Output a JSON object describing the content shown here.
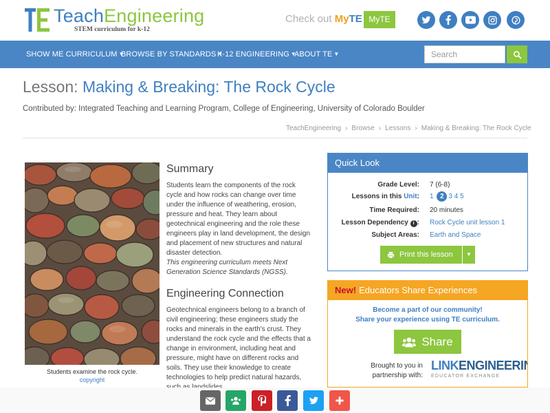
{
  "header": {
    "logo_teach": "Teach",
    "logo_engineering": "Engineering",
    "logo_tagline": "STEM curriculum for k-12",
    "checkout_prefix": "Check out ",
    "checkout_my": "My",
    "checkout_te": "TE",
    "myte_button": "MyTE",
    "social_icons": [
      "twitter-icon",
      "facebook-icon",
      "youtube-icon",
      "instagram-icon",
      "pinterest-icon"
    ]
  },
  "nav": {
    "items": [
      {
        "label": "SHOW ME CURRICULUM"
      },
      {
        "label": "BROWSE BY STANDARDS"
      },
      {
        "label": "K-12 ENGINEERING"
      },
      {
        "label": "ABOUT TE"
      }
    ],
    "search_placeholder": "Search"
  },
  "lesson": {
    "title_prefix": "Lesson:",
    "title": "Making & Breaking: The Rock Cycle",
    "contributed_by": "Contributed by: Integrated Teaching and Learning Program, College of Engineering, University of Colorado Boulder",
    "breadcrumbs": [
      "TeachEngineering",
      "Browse",
      "Lessons",
      "Making & Breaking: The Rock Cycle"
    ]
  },
  "image": {
    "caption": "Students examine the rock cycle.",
    "copyright": "copyright"
  },
  "summary": {
    "heading": "Summary",
    "text": "Students learn the components of the rock cycle and how rocks can change over time under the influence of weathering, erosion, pressure and heat. They learn about geotechnical engineering and the role these engineers play in land development, the design and placement of new structures and natural disaster detection.",
    "ngss_note": "This engineering curriculum meets Next Generation Science Standards (NGSS)."
  },
  "engineering_connection": {
    "heading": "Engineering Connection",
    "text": "Geotechnical engineers belong to a branch of civil engineering; these engineers study the rocks and minerals in the earth's crust. They understand the rock cycle and the effects that a change in environment, including heat and pressure, might have on different rocks and soils. They use their knowledge to create technologies to help predict natural hazards, such as landslides"
  },
  "quick_look": {
    "heading": "Quick Look",
    "grade_label": "Grade Level:",
    "grade_value": "7 (6-8)",
    "lessons_label_prefix": "Lessons in this ",
    "lessons_label_unit": "Unit",
    "lessons_label_suffix": ":",
    "lessons": [
      "1",
      "2",
      "3",
      "4",
      "5"
    ],
    "lessons_current": "2",
    "time_label": "Time Required:",
    "time_value": "20 minutes",
    "dependency_label": "Lesson Dependency",
    "dependency_value": "Rock Cycle unit lesson 1",
    "subject_label": "Subject Areas:",
    "subject_value": "Earth and Space",
    "print_button": "Print this lesson"
  },
  "educators": {
    "new_label": "New!",
    "heading": "Educators Share Experiences",
    "line1": "Become a part of our community!",
    "line2": "Share your experience using TE curriculum.",
    "share_button": "Share",
    "brought_line1": "Brought to you in",
    "brought_line2": "partnership with:",
    "partner_link": "LINK",
    "partner_engineering": "ENGINEERING",
    "partner_sub": "EDUCATOR EXCHANGE"
  },
  "share_bar": {
    "buttons": [
      {
        "icon": "email-icon",
        "color": "#666666"
      },
      {
        "icon": "google-classroom-icon",
        "color": "#25a667"
      },
      {
        "icon": "pinterest-icon",
        "color": "#cb2027"
      },
      {
        "icon": "facebook-icon",
        "color": "#3b5998"
      },
      {
        "icon": "twitter-icon",
        "color": "#1da1f2"
      },
      {
        "icon": "more-plus-icon",
        "color": "#f0564a"
      }
    ]
  },
  "colors": {
    "brand_blue": "#4a86c5",
    "brand_green": "#8dc63f",
    "accent_orange": "#f5a623"
  }
}
